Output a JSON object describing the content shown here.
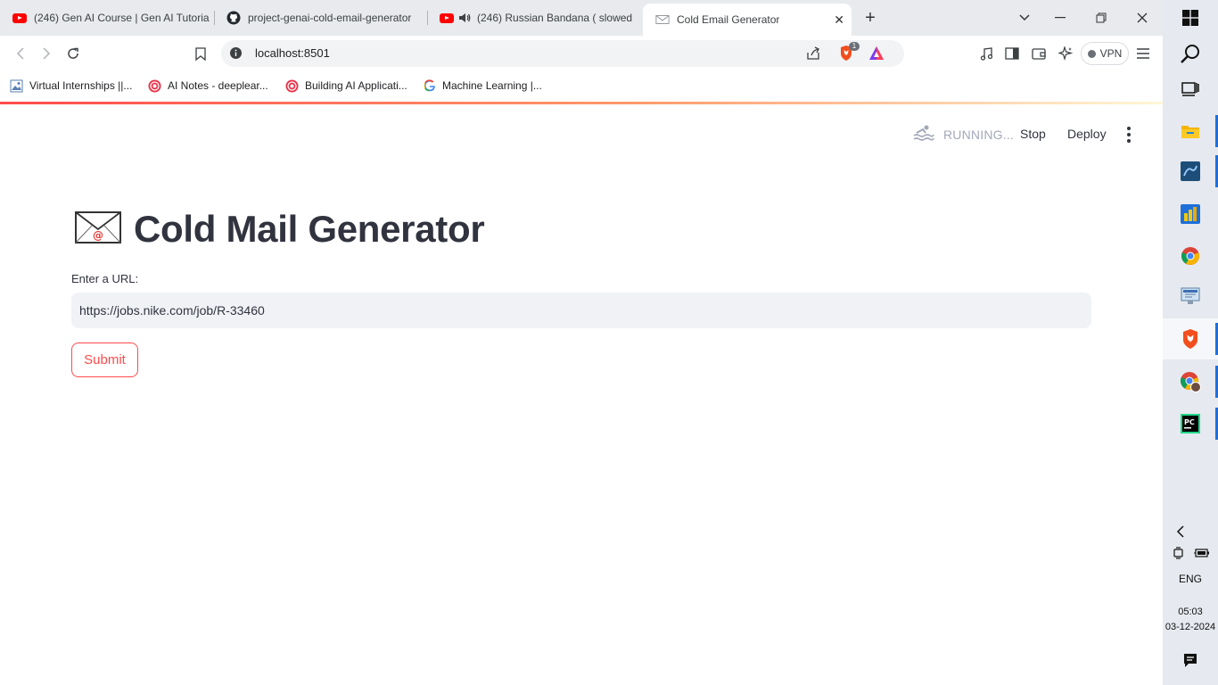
{
  "browser": {
    "tabs": [
      {
        "title": "(246) Gen AI Course | Gen AI Tutoria",
        "icon": "youtube-icon",
        "audio": false
      },
      {
        "title": "project-genai-cold-email-generator",
        "icon": "github-icon",
        "audio": false
      },
      {
        "title": "(246) Russian Bandana ( slowed",
        "icon": "youtube-icon",
        "audio": true
      },
      {
        "title": "Cold Email Generator",
        "icon": "streamlit-icon",
        "audio": false
      }
    ],
    "address": "localhost:8501",
    "brave_badge": "1",
    "vpn_label": "VPN",
    "bookmarks": [
      {
        "label": "Virtual Internships ||...",
        "icon": "image-icon"
      },
      {
        "label": "AI Notes - deeplear...",
        "icon": "deeplearning-icon"
      },
      {
        "label": "Building AI Applicati...",
        "icon": "deeplearning-icon"
      },
      {
        "label": "Machine Learning  |...",
        "icon": "google-icon"
      }
    ]
  },
  "app": {
    "status": "RUNNING...",
    "stop_label": "Stop",
    "deploy_label": "Deploy",
    "title": "Cold Mail Generator",
    "url_label": "Enter a URL:",
    "url_value": "https://jobs.nike.com/job/R-33460",
    "submit_label": "Submit",
    "accent": "#ff4b4b"
  },
  "taskbar": {
    "language": "ENG",
    "time": "05:03",
    "date": "03-12-2024"
  }
}
